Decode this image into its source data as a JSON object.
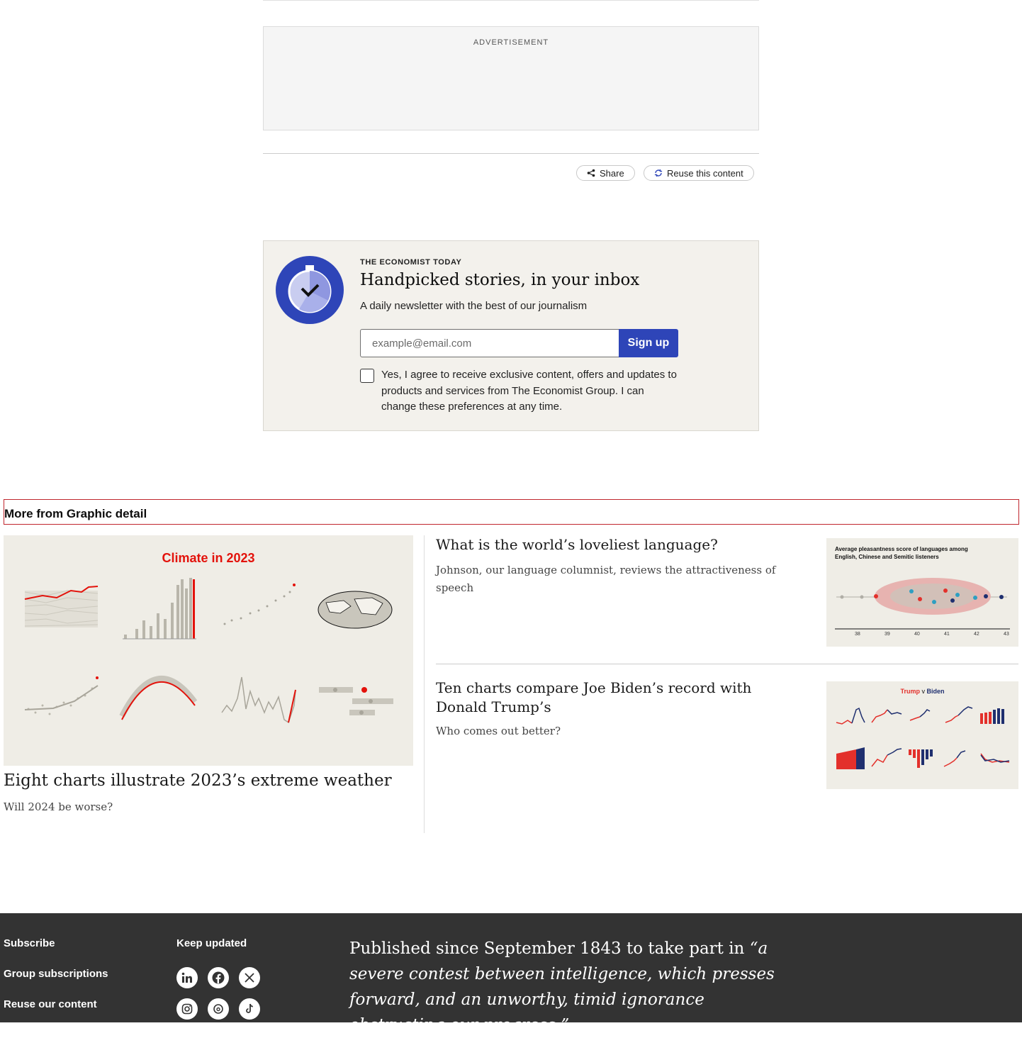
{
  "advertisement": {
    "label": "ADVERTISEMENT"
  },
  "actions": {
    "share_label": "Share",
    "reuse_label": "Reuse this content"
  },
  "newsletter": {
    "eyebrow": "THE ECONOMIST TODAY",
    "title": "Handpicked stories, in your inbox",
    "description": "A daily newsletter with the best of our journalism",
    "email_placeholder": "example@email.com",
    "signup_label": "Sign up",
    "consent_text": "Yes, I agree to receive exclusive content, offers and updates to products and services from The Economist Group. I can change these preferences at any time.",
    "consent_checked": false,
    "icon_colors": {
      "ring": "#2e45b8",
      "face": "#c9cdf0",
      "wedge": "#8f97e0"
    }
  },
  "more": {
    "heading": "More from Graphic detail",
    "accent_color": "#c0262d",
    "articles": [
      {
        "title": "Eight charts illustrate 2023’s extreme weather",
        "subtitle": "Will 2024 be worse?",
        "image_heading": "Climate in 2023"
      },
      {
        "title": "What is the world’s loveliest language?",
        "subtitle": "Johnson, our language columnist, reviews the attractiveness of speech",
        "image_heading": "Average pleasantness score of languages among English, Chinese and Semitic listeners",
        "image_ticks": [
          "38",
          "39",
          "40",
          "41",
          "42",
          "43"
        ]
      },
      {
        "title": "Ten charts compare Joe Biden’s record with Donald Trump’s",
        "subtitle": "Who comes out better?",
        "image_heading_a": "Trump",
        "image_heading_mid": "v",
        "image_heading_b": "Biden"
      }
    ]
  },
  "footer": {
    "links": [
      "Subscribe",
      "Group subscriptions",
      "Reuse our content"
    ],
    "keep_updated": "Keep updated",
    "social_icons": [
      "linkedin-icon",
      "facebook-icon",
      "x-icon",
      "instagram-icon",
      "threads-icon",
      "tiktok-icon"
    ],
    "quote_intro": "Published since September 1843 to take part in",
    "quote_italic": "“a severe contest between intelligence, which presses forward, and an unworthy, timid ignorance obstructing our progress.”",
    "background_color": "#333333"
  }
}
